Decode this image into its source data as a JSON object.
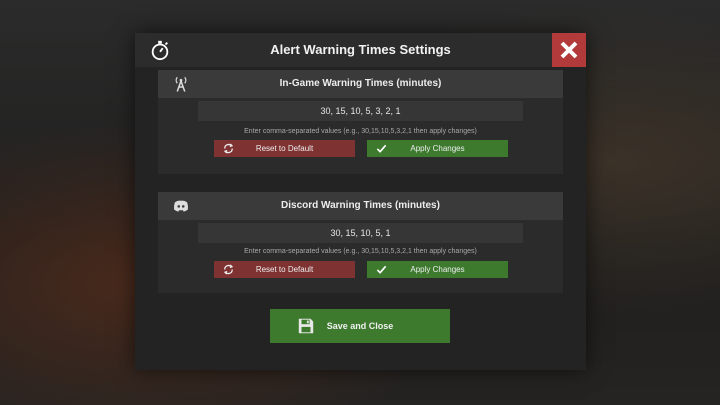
{
  "modal": {
    "title": "Alert Warning Times Settings",
    "title_icon": "stopwatch-icon",
    "close_icon": "close-x-icon"
  },
  "sections": [
    {
      "title": "In-Game Warning Times (minutes)",
      "icon": "broadcast-tower-icon",
      "value": "30, 15, 10, 5, 3, 2, 1",
      "hint": "Enter comma-separated values (e.g., 30,15,10,5,3,2,1 then apply changes)",
      "reset_label": "Reset to Default",
      "apply_label": "Apply Changes"
    },
    {
      "title": "Discord Warning Times (minutes)",
      "icon": "discord-icon",
      "value": "30, 15, 10, 5, 1",
      "hint": "Enter comma-separated values (e.g., 30,15,10,5,3,2,1 then apply changes)",
      "reset_label": "Reset to Default",
      "apply_label": "Apply Changes"
    }
  ],
  "save": {
    "label": "Save and Close",
    "icon": "floppy-disk-icon"
  },
  "colors": {
    "panel_bg": "#232323",
    "section_header": "#3a3a3a",
    "close_red": "#b23a3a",
    "reset_red": "#7e3232",
    "apply_green": "#3d7a2e"
  }
}
